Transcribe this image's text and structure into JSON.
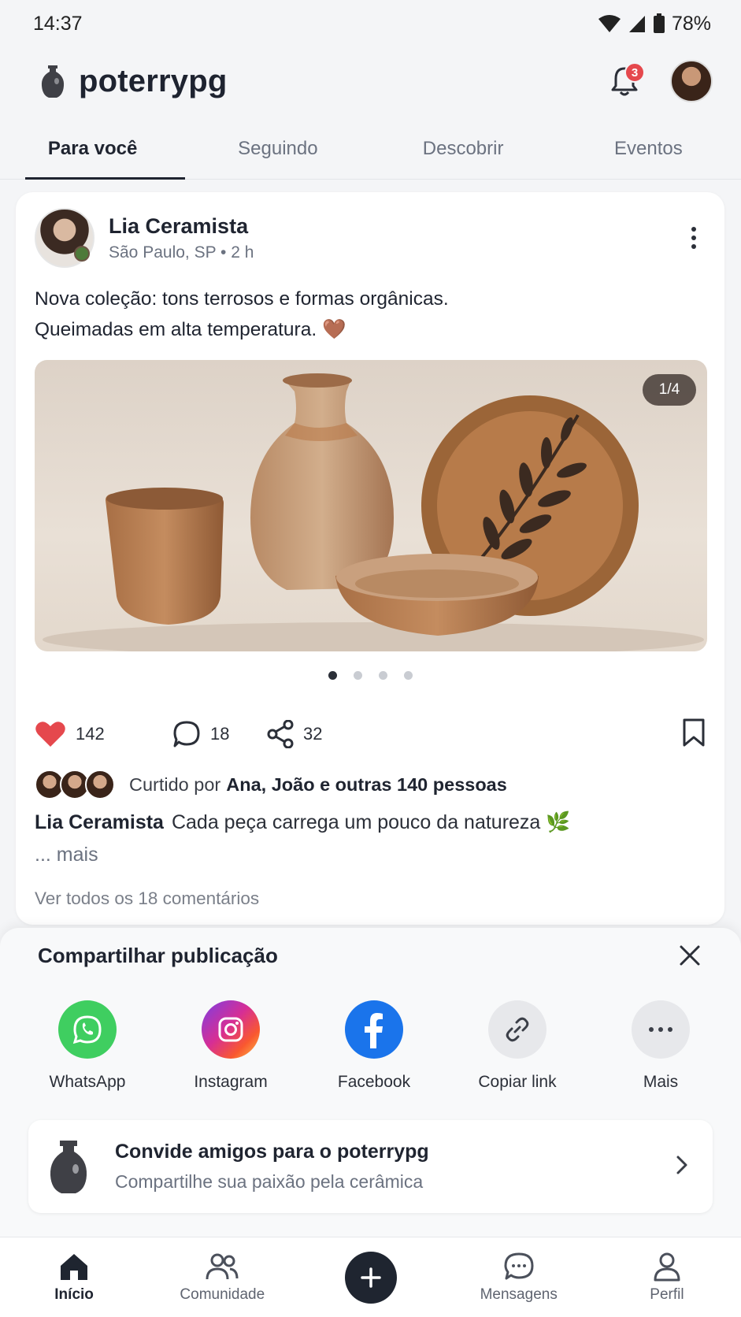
{
  "status_bar": {
    "time": "14:37",
    "battery": "78%"
  },
  "header": {
    "app_name": "poterrypg",
    "notification_count": "3"
  },
  "tabs": [
    {
      "label": "Para você",
      "active": true
    },
    {
      "label": "Seguindo"
    },
    {
      "label": "Descobrir"
    },
    {
      "label": "Eventos"
    }
  ],
  "post": {
    "author": "Lia Ceramista",
    "location_time": "São Paulo, SP • 2 h",
    "caption_line1": "Nova coleção: tons terrosos e formas orgânicas.",
    "caption_line2": "Queimadas em alta temperatura. 🤎",
    "media_counter": "1/4",
    "media_total": 4,
    "media_current": 1,
    "likes": "142",
    "comments": "18",
    "shares": "32",
    "liked_by_prefix": "Curtido por",
    "liked_by_names": "Ana, João e outras 140 pessoas",
    "description_author": "Lia Ceramista",
    "description_text": "Cada peça carrega um pouco da natureza 🌿",
    "more_label": "... mais",
    "view_comments": "Ver todos os 18 comentários"
  },
  "share_sheet": {
    "title": "Compartilhar publicação",
    "options": [
      {
        "label": "WhatsApp",
        "icon": "whatsapp-icon"
      },
      {
        "label": "Instagram",
        "icon": "instagram-icon"
      },
      {
        "label": "Facebook",
        "icon": "facebook-icon"
      },
      {
        "label": "Copiar link",
        "icon": "link-icon"
      },
      {
        "label": "Mais",
        "icon": "more-icon"
      }
    ],
    "invite_title": "Convide amigos para o poterrypg",
    "invite_subtitle": "Compartilhe sua paixão pela cerâmica"
  },
  "bottom_nav": [
    {
      "label": "Início",
      "icon": "home-icon",
      "active": true
    },
    {
      "label": "Comunidade",
      "icon": "community-icon"
    },
    {
      "label": "",
      "icon": "add-icon"
    },
    {
      "label": "Mensagens",
      "icon": "messages-icon"
    },
    {
      "label": "Perfil",
      "icon": "profile-icon"
    }
  ],
  "colors": {
    "like": "#e5484d",
    "accent_dark": "#1f2530",
    "whatsapp": "#3fce60",
    "facebook": "#1a74eb"
  }
}
